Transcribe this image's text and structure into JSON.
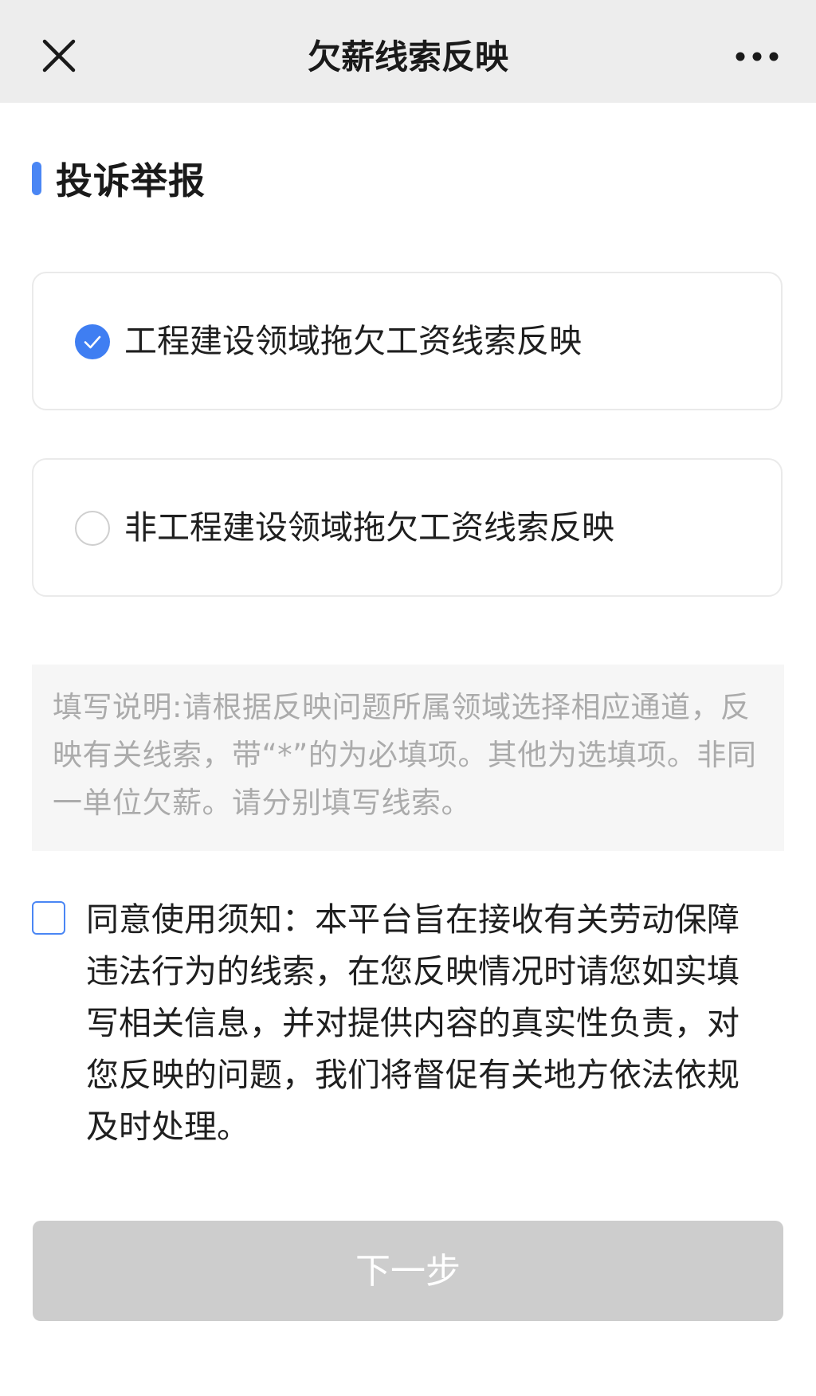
{
  "nav": {
    "title": "欠薪线索反映",
    "close_icon": "close-icon",
    "more_icon": "more-dots-icon"
  },
  "section": {
    "title": "投诉举报",
    "accent_color": "#4a86f4"
  },
  "options": [
    {
      "label": "工程建设领域拖欠工资线索反映",
      "selected": true
    },
    {
      "label": "非工程建设领域拖欠工资线索反映",
      "selected": false
    }
  ],
  "notice": {
    "text": "填写说明:请根据反映问题所属领域选择相应通道，反映有关线索，带“*”的为必填项。其他为选填项。非同一单位欠薪。请分别填写线索。"
  },
  "agreement": {
    "checked": false,
    "text": "同意使用须知：本平台旨在接收有关劳动保障违法行为的线索，在您反映情况时请您如实填写相关信息，并对提供内容的真实性负责，对您反映的问题，我们将督促有关地方依法依规及时处理。"
  },
  "next_button": {
    "label": "下一步",
    "disabled": true
  },
  "colors": {
    "primary": "#3f7ef2",
    "nav_background": "#ededed",
    "disabled_button": "#cdcdcd"
  }
}
